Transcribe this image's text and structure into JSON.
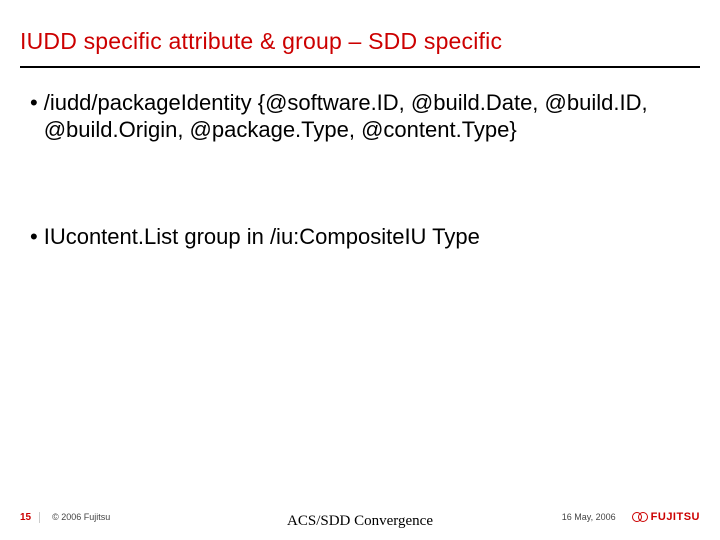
{
  "title": "IUDD specific attribute & group – SDD specific",
  "bullets": [
    "/iudd/packageIdentity {@software.ID, @build.Date, @build.ID, @build.Origin, @package.Type, @content.Type}",
    "IUcontent.List group in /iu:CompositeIU Type"
  ],
  "footer": {
    "page": "15",
    "copyright": "© 2006 Fujitsu",
    "center": "ACS/SDD Convergence",
    "date": "16 May, 2006",
    "logo_text": "FUJITSU"
  }
}
